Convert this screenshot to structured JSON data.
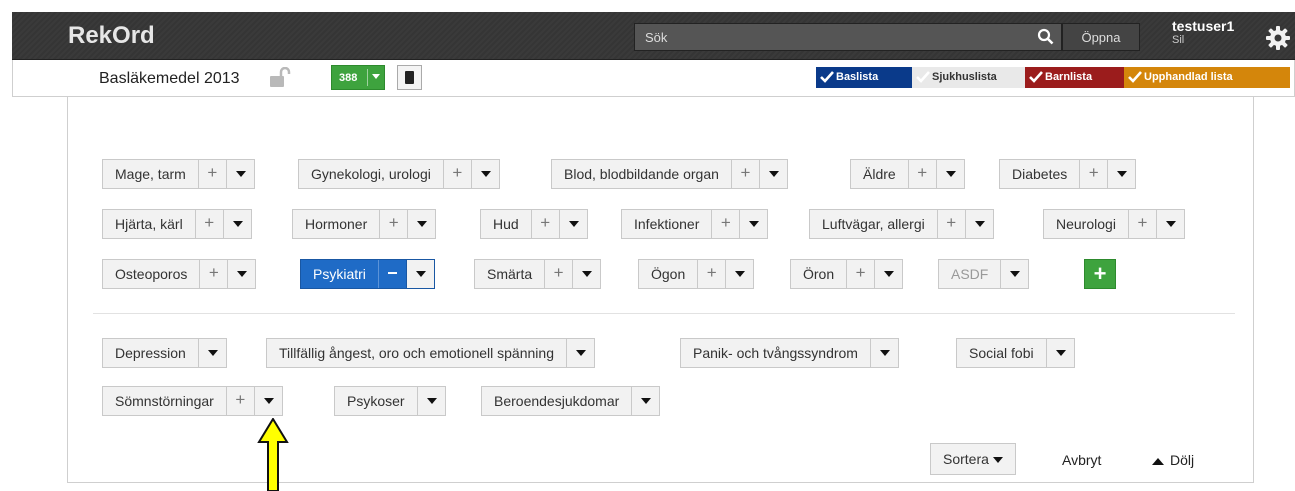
{
  "header": {
    "logo": "RekOrd",
    "search_placeholder": "Sök",
    "open_label": "Öppna",
    "user_name": "testuser1",
    "user_sub": "Sil"
  },
  "listbar": {
    "list_name": "Basläkemedel 2013",
    "count": "388",
    "tags": [
      "Baslista",
      "Sjukhuslista",
      "Barnlista",
      "Upphandlad lista"
    ],
    "tag_colors": [
      "#0a3a8a",
      "#e9e9e9",
      "#9b1c1c",
      "#d4860b"
    ]
  },
  "categories": [
    {
      "label": "Mage, tarm"
    },
    {
      "label": "Gynekologi, urologi"
    },
    {
      "label": "Blod, blodbildande organ"
    },
    {
      "label": "Äldre"
    },
    {
      "label": "Diabetes"
    },
    {
      "label": "Hjärta, kärl"
    },
    {
      "label": "Hormoner"
    },
    {
      "label": "Hud"
    },
    {
      "label": "Infektioner"
    },
    {
      "label": "Luftvägar, allergi"
    },
    {
      "label": "Neurologi"
    },
    {
      "label": "Osteoporos"
    },
    {
      "label": "Psykiatri",
      "active": true
    },
    {
      "label": "Smärta"
    },
    {
      "label": "Ögon"
    },
    {
      "label": "Öron"
    },
    {
      "label": "ASDF"
    }
  ],
  "subcategories": [
    {
      "label": "Depression"
    },
    {
      "label": "Tillfällig ångest, oro och emotionell spänning"
    },
    {
      "label": "Panik- och tvångssyndrom"
    },
    {
      "label": "Social fobi"
    },
    {
      "label": "Sömnstörningar"
    },
    {
      "label": "Psykoser"
    },
    {
      "label": "Beroendesjukdomar"
    }
  ],
  "footer": {
    "sort_label": "Sortera",
    "cancel_label": "Avbryt",
    "hide_label": "Dölj"
  },
  "colors": {
    "accent": "#1f6bc6",
    "green": "#3ea33e",
    "arrow": "#ffff00"
  }
}
